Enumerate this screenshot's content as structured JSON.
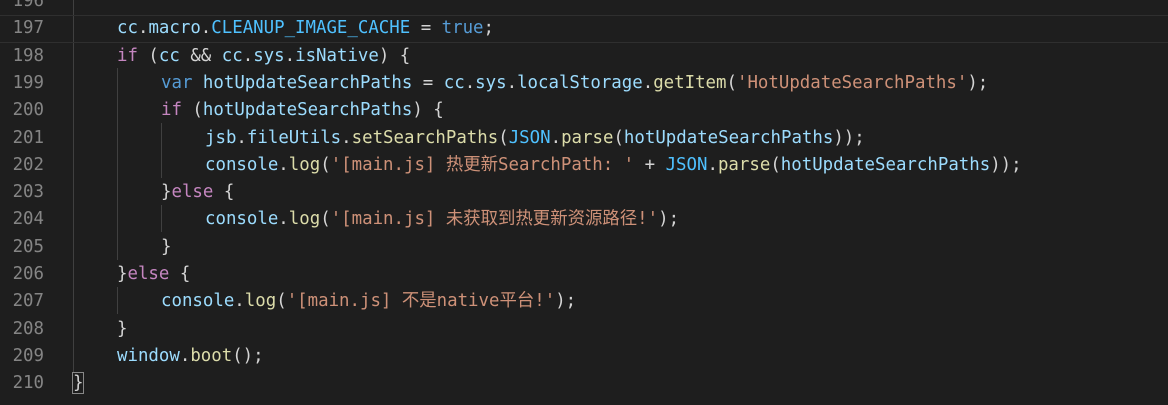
{
  "editor": {
    "lines": [
      {
        "number": "196",
        "tokens": []
      },
      {
        "number": "197",
        "tokens": [
          {
            "c": "t-ident",
            "t": "cc"
          },
          {
            "c": "t-plain",
            "t": "."
          },
          {
            "c": "t-ident",
            "t": "macro"
          },
          {
            "c": "t-plain",
            "t": "."
          },
          {
            "c": "t-const",
            "t": "CLEANUP_IMAGE_CACHE"
          },
          {
            "c": "t-plain",
            "t": " = "
          },
          {
            "c": "t-kw",
            "t": "true"
          },
          {
            "c": "t-plain",
            "t": ";"
          }
        ]
      },
      {
        "number": "198",
        "tokens": [
          {
            "c": "t-ctrl",
            "t": "if"
          },
          {
            "c": "t-plain",
            "t": " ("
          },
          {
            "c": "t-ident",
            "t": "cc"
          },
          {
            "c": "t-plain",
            "t": " && "
          },
          {
            "c": "t-ident",
            "t": "cc"
          },
          {
            "c": "t-plain",
            "t": "."
          },
          {
            "c": "t-ident",
            "t": "sys"
          },
          {
            "c": "t-plain",
            "t": "."
          },
          {
            "c": "t-ident",
            "t": "isNative"
          },
          {
            "c": "t-plain",
            "t": ") {"
          }
        ]
      },
      {
        "number": "199",
        "tokens": [
          {
            "c": "t-kw",
            "t": "var"
          },
          {
            "c": "t-plain",
            "t": " "
          },
          {
            "c": "t-ident",
            "t": "hotUpdateSearchPaths"
          },
          {
            "c": "t-plain",
            "t": " = "
          },
          {
            "c": "t-ident",
            "t": "cc"
          },
          {
            "c": "t-plain",
            "t": "."
          },
          {
            "c": "t-ident",
            "t": "sys"
          },
          {
            "c": "t-plain",
            "t": "."
          },
          {
            "c": "t-ident",
            "t": "localStorage"
          },
          {
            "c": "t-plain",
            "t": "."
          },
          {
            "c": "t-fn",
            "t": "getItem"
          },
          {
            "c": "t-plain",
            "t": "("
          },
          {
            "c": "t-str",
            "t": "'HotUpdateSearchPaths'"
          },
          {
            "c": "t-plain",
            "t": ");"
          }
        ]
      },
      {
        "number": "200",
        "tokens": [
          {
            "c": "t-ctrl",
            "t": "if"
          },
          {
            "c": "t-plain",
            "t": " ("
          },
          {
            "c": "t-ident",
            "t": "hotUpdateSearchPaths"
          },
          {
            "c": "t-plain",
            "t": ") {"
          }
        ]
      },
      {
        "number": "201",
        "tokens": [
          {
            "c": "t-ident",
            "t": "jsb"
          },
          {
            "c": "t-plain",
            "t": "."
          },
          {
            "c": "t-ident",
            "t": "fileUtils"
          },
          {
            "c": "t-plain",
            "t": "."
          },
          {
            "c": "t-fn",
            "t": "setSearchPaths"
          },
          {
            "c": "t-plain",
            "t": "("
          },
          {
            "c": "t-const",
            "t": "JSON"
          },
          {
            "c": "t-plain",
            "t": "."
          },
          {
            "c": "t-fn",
            "t": "parse"
          },
          {
            "c": "t-plain",
            "t": "("
          },
          {
            "c": "t-ident",
            "t": "hotUpdateSearchPaths"
          },
          {
            "c": "t-plain",
            "t": "));"
          }
        ]
      },
      {
        "number": "202",
        "tokens": [
          {
            "c": "t-ident",
            "t": "console"
          },
          {
            "c": "t-plain",
            "t": "."
          },
          {
            "c": "t-fn",
            "t": "log"
          },
          {
            "c": "t-plain",
            "t": "("
          },
          {
            "c": "t-str",
            "t": "'[main.js] 热更新SearchPath: '"
          },
          {
            "c": "t-plain",
            "t": " + "
          },
          {
            "c": "t-const",
            "t": "JSON"
          },
          {
            "c": "t-plain",
            "t": "."
          },
          {
            "c": "t-fn",
            "t": "parse"
          },
          {
            "c": "t-plain",
            "t": "("
          },
          {
            "c": "t-ident",
            "t": "hotUpdateSearchPaths"
          },
          {
            "c": "t-plain",
            "t": "));"
          }
        ]
      },
      {
        "number": "203",
        "tokens": [
          {
            "c": "t-plain",
            "t": "}"
          },
          {
            "c": "t-ctrl",
            "t": "else"
          },
          {
            "c": "t-plain",
            "t": " {"
          }
        ]
      },
      {
        "number": "204",
        "tokens": [
          {
            "c": "t-ident",
            "t": "console"
          },
          {
            "c": "t-plain",
            "t": "."
          },
          {
            "c": "t-fn",
            "t": "log"
          },
          {
            "c": "t-plain",
            "t": "("
          },
          {
            "c": "t-str",
            "t": "'[main.js] 未获取到热更新资源路径!'"
          },
          {
            "c": "t-plain",
            "t": ");"
          }
        ]
      },
      {
        "number": "205",
        "tokens": [
          {
            "c": "t-plain",
            "t": "}"
          }
        ]
      },
      {
        "number": "206",
        "tokens": [
          {
            "c": "t-plain",
            "t": "}"
          },
          {
            "c": "t-ctrl",
            "t": "else"
          },
          {
            "c": "t-plain",
            "t": " {"
          }
        ]
      },
      {
        "number": "207",
        "tokens": [
          {
            "c": "t-ident",
            "t": "console"
          },
          {
            "c": "t-plain",
            "t": "."
          },
          {
            "c": "t-fn",
            "t": "log"
          },
          {
            "c": "t-plain",
            "t": "("
          },
          {
            "c": "t-str",
            "t": "'[main.js] 不是native平台!'"
          },
          {
            "c": "t-plain",
            "t": ");"
          }
        ]
      },
      {
        "number": "208",
        "tokens": [
          {
            "c": "t-plain",
            "t": "}"
          }
        ]
      },
      {
        "number": "209",
        "tokens": [
          {
            "c": "t-ident",
            "t": "window"
          },
          {
            "c": "t-plain",
            "t": "."
          },
          {
            "c": "t-fn",
            "t": "boot"
          },
          {
            "c": "t-plain",
            "t": "();"
          }
        ]
      },
      {
        "number": "210",
        "tokens": [
          {
            "c": "t-plain",
            "t": "}"
          }
        ]
      }
    ]
  }
}
